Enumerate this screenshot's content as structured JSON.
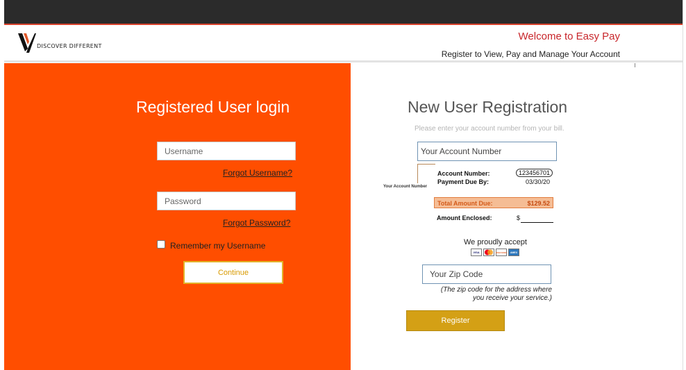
{
  "header": {
    "logo_text": "DISCOVER DIFFERENT",
    "welcome": "Welcome to Easy Pay",
    "subtitle": "Register to View, Pay and Manage Your Account"
  },
  "login": {
    "title": "Registered User login",
    "username_placeholder": "Username",
    "forgot_username": "Forgot Username?",
    "password_placeholder": "Password",
    "forgot_password": "Forgot Password?",
    "remember_label": "Remember my Username",
    "remember_checked": false,
    "continue_label": "Continue"
  },
  "registration": {
    "title": "New User Registration",
    "hint": "Please enter your account number from your bill.",
    "account_placeholder": "Your Account Number",
    "bill_sample": {
      "pointer_label": "Your Account Number",
      "account_number_label": "Account Number:",
      "account_number_value": "123456701",
      "payment_due_label": "Payment Due By:",
      "payment_due_value": "03/30/20",
      "total_due_label": "Total Amount Due:",
      "total_due_value": "$129.52",
      "amount_enclosed_label": "Amount Enclosed:",
      "amount_enclosed_value": "$"
    },
    "accept_text": "We proudly accept",
    "cards": [
      {
        "name": "visa-icon",
        "label": "VISA"
      },
      {
        "name": "mastercard-icon",
        "label": ""
      },
      {
        "name": "discover-icon",
        "label": "DISCOVER"
      },
      {
        "name": "amex-icon",
        "label": "AMEX"
      }
    ],
    "zip_placeholder": "Your Zip Code",
    "zip_note": "(The zip code for the address where you receive your service.)",
    "register_label": "Register"
  },
  "colors": {
    "top_bar": "#2b2b2b",
    "login_panel": "#ff4e00",
    "welcome_text": "#c8262b",
    "register_button": "#d4a015",
    "continue_border": "#e2b328"
  }
}
